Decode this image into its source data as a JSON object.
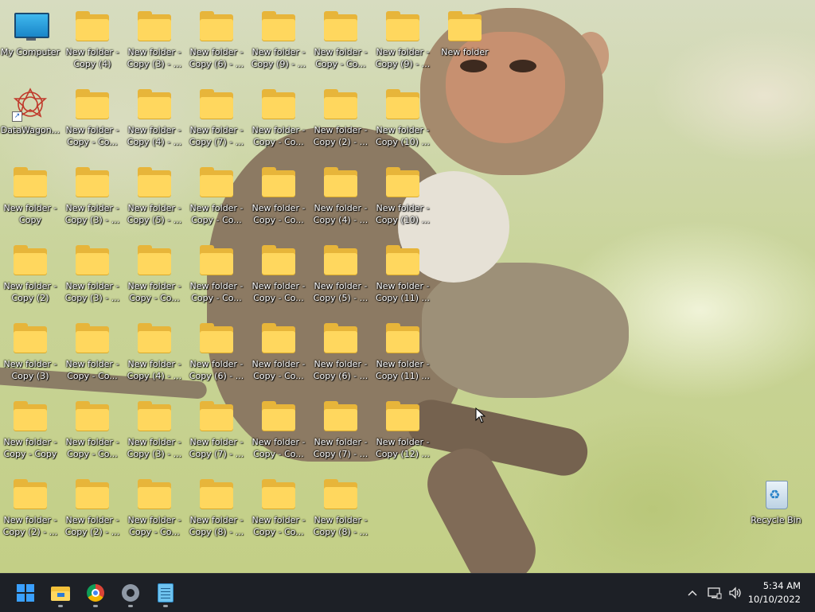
{
  "desktop": {
    "icons": [
      {
        "label": "My Computer",
        "type": "computer"
      },
      {
        "label": "DataWagon...",
        "type": "app"
      },
      {
        "label": "New folder -\nCopy",
        "type": "folder"
      },
      {
        "label": "New folder -\nCopy (2)",
        "type": "folder"
      },
      {
        "label": "New folder -\nCopy (3)",
        "type": "folder"
      },
      {
        "label": "New folder -\nCopy - Copy",
        "type": "folder"
      },
      {
        "label": "New folder -\nCopy (2) - ...",
        "type": "folder"
      },
      {
        "label": "New folder -\nCopy (4)",
        "type": "folder"
      },
      {
        "label": "New folder -\nCopy - Co...",
        "type": "folder"
      },
      {
        "label": "New folder -\nCopy (3) - ...",
        "type": "folder"
      },
      {
        "label": "New folder -\nCopy (3) - ...",
        "type": "folder"
      },
      {
        "label": "New folder -\nCopy - Co...",
        "type": "folder"
      },
      {
        "label": "New folder -\nCopy - Co...",
        "type": "folder"
      },
      {
        "label": "New folder -\nCopy (2) - ...",
        "type": "folder"
      },
      {
        "label": "New folder -\nCopy (3) - ...",
        "type": "folder"
      },
      {
        "label": "New folder -\nCopy (4) - ...",
        "type": "folder"
      },
      {
        "label": "New folder -\nCopy (5) - ...",
        "type": "folder"
      },
      {
        "label": "New folder -\nCopy - Co...",
        "type": "folder"
      },
      {
        "label": "New folder -\nCopy (4) - ...",
        "type": "folder"
      },
      {
        "label": "New folder -\nCopy (3) - ...",
        "type": "folder"
      },
      {
        "label": "New folder -\nCopy - Co...",
        "type": "folder"
      },
      {
        "label": "New folder -\nCopy (6) - ...",
        "type": "folder"
      },
      {
        "label": "New folder -\nCopy (7) - ...",
        "type": "folder"
      },
      {
        "label": "New folder -\nCopy - Co...",
        "type": "folder"
      },
      {
        "label": "New folder -\nCopy - Co...",
        "type": "folder"
      },
      {
        "label": "New folder -\nCopy (6) - ...",
        "type": "folder"
      },
      {
        "label": "New folder -\nCopy (7) - ...",
        "type": "folder"
      },
      {
        "label": "New folder -\nCopy (8) - ...",
        "type": "folder"
      },
      {
        "label": "New folder -\nCopy (9) - ...",
        "type": "folder"
      },
      {
        "label": "New folder -\nCopy - Co...",
        "type": "folder"
      },
      {
        "label": "New folder -\nCopy - Co...",
        "type": "folder"
      },
      {
        "label": "New folder -\nCopy - Co...",
        "type": "folder"
      },
      {
        "label": "New folder -\nCopy - Co...",
        "type": "folder"
      },
      {
        "label": "New folder -\nCopy - Co...",
        "type": "folder"
      },
      {
        "label": "New folder -\nCopy - Co...",
        "type": "folder"
      },
      {
        "label": "New folder -\nCopy - Co...",
        "type": "folder"
      },
      {
        "label": "New folder -\nCopy (2) - ...",
        "type": "folder"
      },
      {
        "label": "New folder -\nCopy (4) - ...",
        "type": "folder"
      },
      {
        "label": "New folder -\nCopy (5) - ...",
        "type": "folder"
      },
      {
        "label": "New folder -\nCopy (6) - ...",
        "type": "folder"
      },
      {
        "label": "New folder -\nCopy (7) - ...",
        "type": "folder"
      },
      {
        "label": "New folder -\nCopy (8) - ...",
        "type": "folder"
      },
      {
        "label": "New folder -\nCopy (9) - ...",
        "type": "folder"
      },
      {
        "label": "New folder -\nCopy (10) ...",
        "type": "folder"
      },
      {
        "label": "New folder -\nCopy (10) ...",
        "type": "folder"
      },
      {
        "label": "New folder -\nCopy (11) ...",
        "type": "folder"
      },
      {
        "label": "New folder -\nCopy (11) ...",
        "type": "folder"
      },
      {
        "label": "New folder -\nCopy (12) ...",
        "type": "folder"
      },
      {
        "label": "New folder",
        "type": "folder"
      },
      {
        "label": "Recycle Bin",
        "type": "recycle"
      }
    ]
  },
  "taskbar": {
    "apps": [
      {
        "name": "start-button",
        "icon": "windows-start-icon"
      },
      {
        "name": "file-explorer",
        "icon": "folder-icon"
      },
      {
        "name": "chrome",
        "icon": "chrome-icon"
      },
      {
        "name": "settings",
        "icon": "gear-icon"
      },
      {
        "name": "notepad",
        "icon": "notepad-icon"
      }
    ],
    "tray": {
      "chevron": "^",
      "time": "5:34 AM",
      "date": "10/10/2022"
    }
  }
}
